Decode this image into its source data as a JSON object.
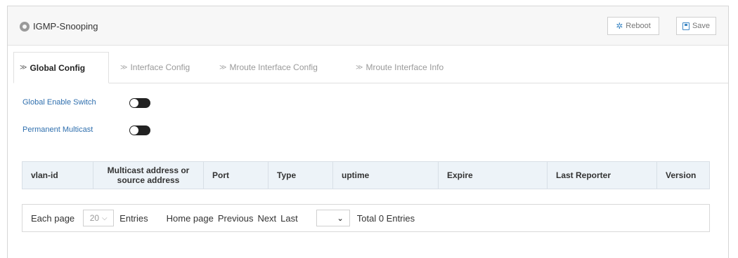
{
  "header": {
    "title": "IGMP-Snooping",
    "reboot_label": "Reboot",
    "save_label": "Save"
  },
  "tabs": [
    {
      "label": "Global Config",
      "active": true
    },
    {
      "label": "Interface Config",
      "active": false
    },
    {
      "label": "Mroute Interface Config",
      "active": false
    },
    {
      "label": "Mroute Interface Info",
      "active": false
    }
  ],
  "settings": {
    "global_enable_label": "Global Enable Switch",
    "global_enable_on": false,
    "permanent_multicast_label": "Permanent Multicast",
    "permanent_multicast_on": false
  },
  "table": {
    "columns": [
      "vlan-id",
      "Multicast address or source address",
      "Port",
      "Type",
      "uptime",
      "Expire",
      "Last Reporter",
      "Version"
    ],
    "rows": []
  },
  "pager": {
    "each_page_label": "Each page",
    "per_page_value": "20",
    "entries_label": "Entries",
    "home_label": "Home page",
    "previous_label": "Previous",
    "next_label": "Next",
    "last_label": "Last",
    "page_value": "",
    "total_text": "Total 0 Entries"
  },
  "colors": {
    "accent": "#2f6fae",
    "header_bg": "#edf3f8",
    "toggle_off": "#222222"
  }
}
